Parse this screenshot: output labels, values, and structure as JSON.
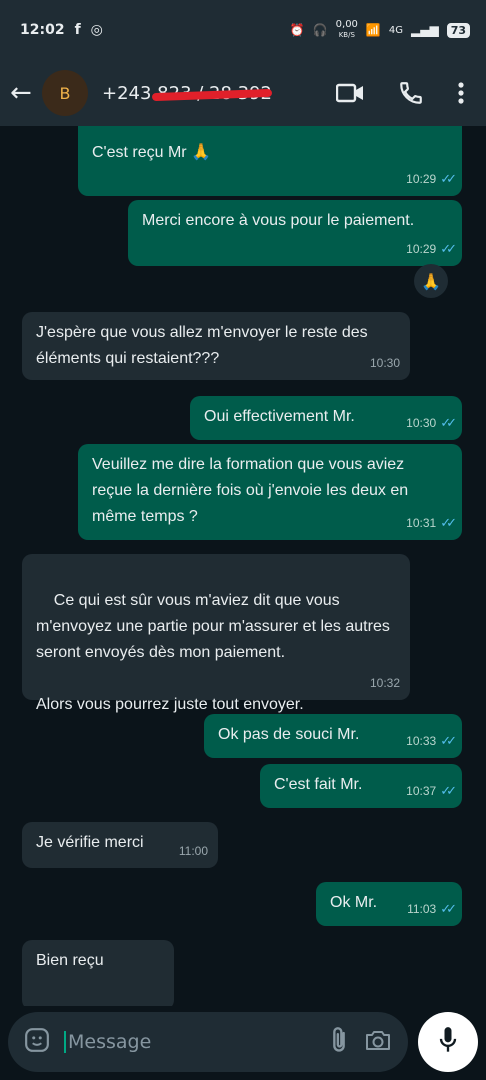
{
  "status_bar": {
    "time": "12:02",
    "data_rate": "0,00",
    "data_unit": "KB/S",
    "network": "4G",
    "battery": "73"
  },
  "header": {
    "avatar_initial": "B",
    "contact_number": "+243 823 / 28 392"
  },
  "messages": [
    {
      "dir": "out",
      "text": "C'est reçu Mr 🙏",
      "time": "10:29"
    },
    {
      "dir": "out",
      "text": "Merci encore à vous pour le paiement.",
      "time": "10:29"
    },
    {
      "dir": "reaction",
      "text": "🙏"
    },
    {
      "dir": "in",
      "text": "J'espère que vous allez m'envoyer le reste des éléments qui restaient???",
      "time": "10:30"
    },
    {
      "dir": "out",
      "text": "Oui effectivement Mr.",
      "time": "10:30"
    },
    {
      "dir": "out",
      "text": "Veuillez me dire la formation que vous aviez reçue la dernière fois où j'envoie les deux en même temps ?",
      "time": "10:31"
    },
    {
      "dir": "in",
      "text": "Ce qui est sûr vous m'aviez dit que vous m'envoyez une partie pour m'assurer et les autres seront envoyés dès mon paiement.\n\nAlors vous pourrez juste tout envoyer.",
      "time": "10:32"
    },
    {
      "dir": "out",
      "text": "Ok pas de souci Mr.",
      "time": "10:33"
    },
    {
      "dir": "out",
      "text": "C'est fait Mr.",
      "time": "10:37"
    },
    {
      "dir": "in",
      "text": "Je vérifie merci",
      "time": "11:00"
    },
    {
      "dir": "out",
      "text": "Ok Mr.",
      "time": "11:03"
    },
    {
      "dir": "in",
      "text": "Bien reçu",
      "time": ""
    }
  ],
  "composer": {
    "placeholder": "Message"
  },
  "colors": {
    "outgoing_bubble": "#005c4b",
    "incoming_bubble": "#202c33",
    "read_ticks": "#53bdeb",
    "background": "#0b141a"
  }
}
